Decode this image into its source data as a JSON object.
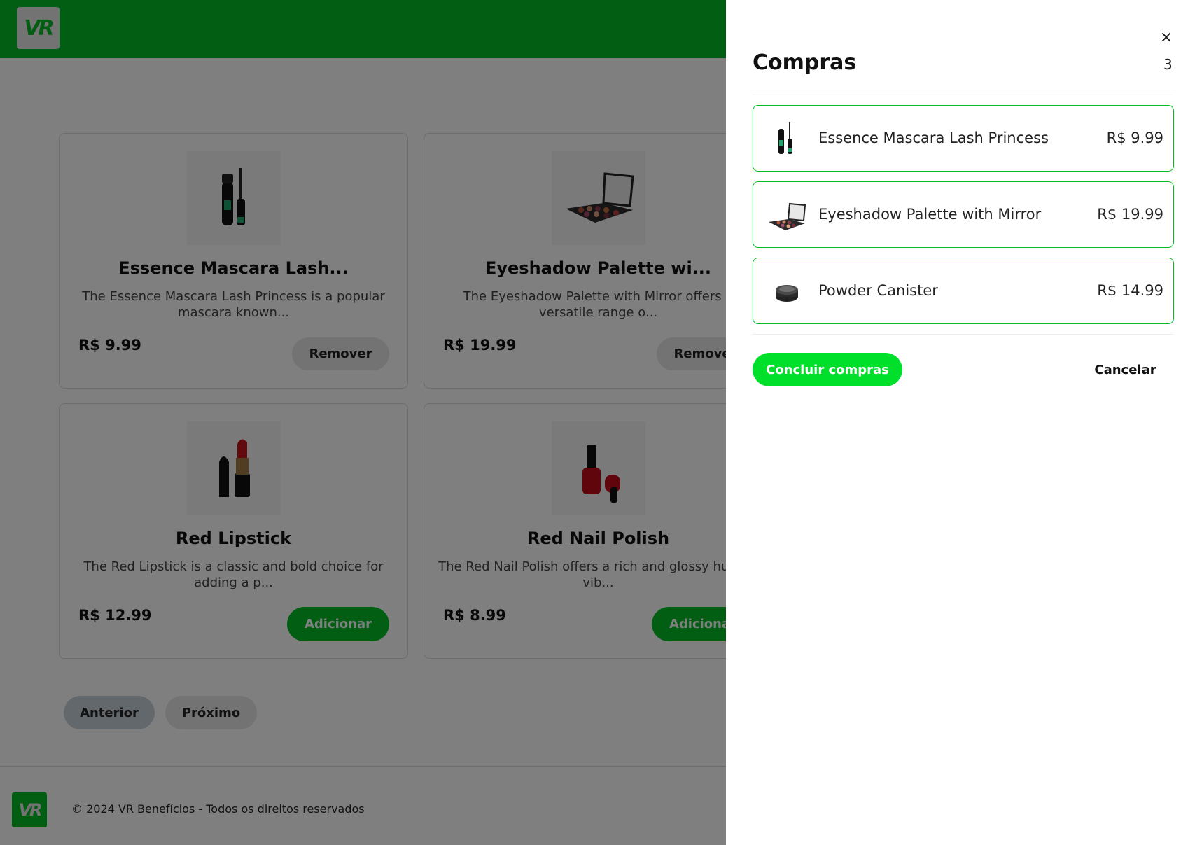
{
  "header": {
    "logo_text": "VR",
    "brand_color": "#05bd25"
  },
  "products": [
    {
      "title": "Essence Mascara Lash...",
      "description": "The Essence Mascara Lash Princess is a popular mascara known...",
      "price": "R$ 9.99",
      "button": "Remover",
      "image_icon": "mascara-icon"
    },
    {
      "title": "Eyeshadow Palette wi...",
      "description": "The Eyeshadow Palette with Mirror offers a versatile range o...",
      "price": "R$ 19.99",
      "button": "Remover",
      "image_icon": "eyeshadow-palette-icon"
    },
    {
      "title": "Red Lipstick",
      "description": "The Red Lipstick is a classic and bold choice for adding a p...",
      "price": "R$ 12.99",
      "button": "Adicionar",
      "image_icon": "lipstick-icon"
    },
    {
      "title": "Red Nail Polish",
      "description": "The Red Nail Polish offers a rich and glossy hue for vib...",
      "price": "R$ 8.99",
      "button": "Adicionar",
      "image_icon": "nail-polish-icon"
    }
  ],
  "pagination": {
    "prev": "Anterior",
    "next": "Próximo"
  },
  "footer": {
    "logo_text": "VR",
    "text": "© 2024 VR Benefícios - Todos os direitos reservados"
  },
  "cart": {
    "title": "Compras",
    "count": "3",
    "close_icon": "×",
    "items": [
      {
        "name": "Essence Mascara Lash Princess",
        "price": "R$ 9.99",
        "image_icon": "mascara-icon"
      },
      {
        "name": "Eyeshadow Palette with Mirror",
        "price": "R$ 19.99",
        "image_icon": "eyeshadow-palette-icon"
      },
      {
        "name": "Powder Canister",
        "price": "R$ 14.99",
        "image_icon": "powder-canister-icon"
      }
    ],
    "checkout_label": "Concluir compras",
    "cancel_label": "Cancelar",
    "checkout_color": "#00e02a"
  }
}
